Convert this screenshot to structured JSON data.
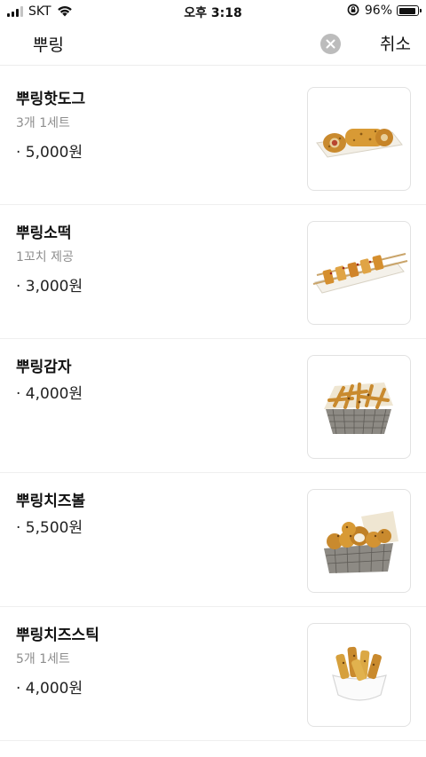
{
  "status_bar": {
    "carrier": "SKT",
    "time": "오후 3:18",
    "battery_percent": "96%",
    "battery_level": 0.96,
    "icons": [
      "signal-icon",
      "wifi-icon",
      "rotation-lock-icon",
      "battery-icon"
    ]
  },
  "search": {
    "query": "뿌링",
    "cancel_label": "취소",
    "clear_icon": "close-icon"
  },
  "menu": {
    "items": [
      {
        "name": "뿌링핫도그",
        "desc": "3개 1세트",
        "price": "· 5,000원",
        "image": "hotdog-image"
      },
      {
        "name": "뿌링소떡",
        "desc": "1꼬치 제공",
        "price": "· 3,000원",
        "image": "skewer-image"
      },
      {
        "name": "뿌링감자",
        "desc": "",
        "price": "· 4,000원",
        "image": "fries-basket-image"
      },
      {
        "name": "뿌링치즈볼",
        "desc": "",
        "price": "· 5,500원",
        "image": "cheeseball-basket-image"
      },
      {
        "name": "뿌링치즈스틱",
        "desc": "5개 1세트",
        "price": "· 4,000원",
        "image": "cheesestick-bowl-image"
      }
    ]
  }
}
